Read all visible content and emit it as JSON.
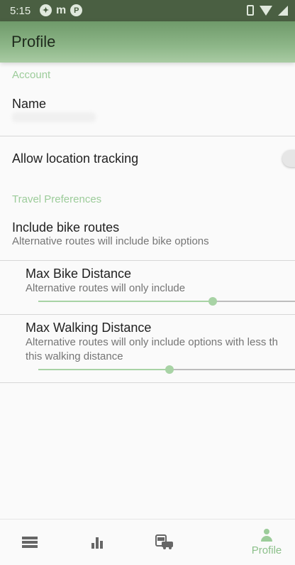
{
  "status_bar": {
    "time": "5:15",
    "app_icons": [
      "messenger",
      "m",
      "p"
    ]
  },
  "app_bar": {
    "title": "Profile"
  },
  "sections": {
    "account_header": "Account",
    "travel_header": "Travel Preferences"
  },
  "account": {
    "name_label": "Name"
  },
  "location": {
    "label": "Allow location tracking",
    "enabled": false
  },
  "bike_routes": {
    "title": "Include bike routes",
    "subtitle": "Alternative routes will include bike options"
  },
  "max_bike": {
    "title": "Max Bike Distance",
    "subtitle": "Alternative routes will only include",
    "level": 0.68
  },
  "max_walking": {
    "title": "Max Walking Distance",
    "subtitle_line1": "Alternative routes will only include options with less th",
    "subtitle_line2": "this walking distance",
    "level": 0.51
  },
  "bottom_nav": {
    "items": [
      {
        "icon": "list-icon",
        "label": ""
      },
      {
        "icon": "bar-chart-icon",
        "label": ""
      },
      {
        "icon": "bus-car-icon",
        "label": ""
      },
      {
        "icon": "person-icon",
        "label": "Profile"
      }
    ]
  },
  "colors": {
    "accent": "#9ccc9a",
    "app_bar": "#8db688",
    "status_bar": "#4a5f42"
  }
}
